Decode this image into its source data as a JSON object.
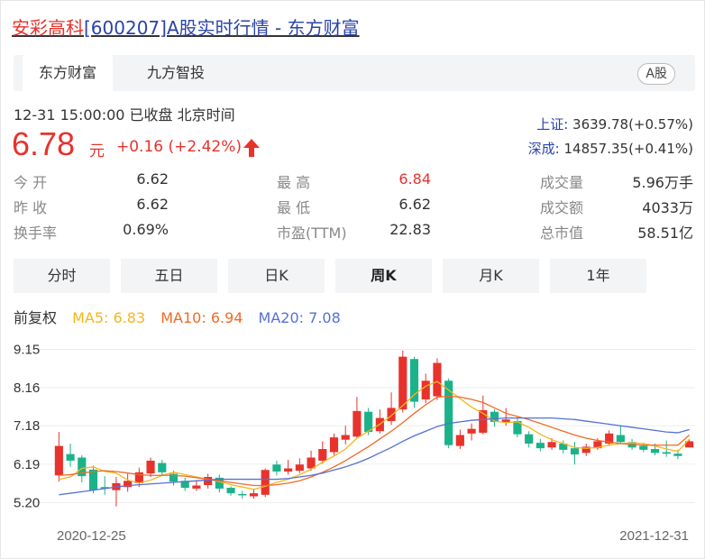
{
  "title": {
    "name": "安彩高科",
    "rest": "[600207]A股实时行情 - 东方财富"
  },
  "tabs": [
    {
      "label": "东方财富",
      "active": true
    },
    {
      "label": "九方智投",
      "active": false
    }
  ],
  "market_badge": "A股",
  "status": "12-31 15:00:00  已收盘  北京时间",
  "indices": [
    {
      "name": "上证:",
      "value": "3639.78(+0.57%)"
    },
    {
      "name": "深成:",
      "value": "14857.35(+0.41%)"
    }
  ],
  "quote": {
    "price": "6.78",
    "unit": "元",
    "change": "+0.16 (+2.42%)",
    "direction": "up"
  },
  "stats": [
    {
      "label": "今 开",
      "value": "6.62",
      "up": false
    },
    {
      "label": "最 高",
      "value": "6.84",
      "up": true
    },
    {
      "label": "成交量",
      "value": "5.96万手",
      "up": false
    },
    {
      "label": "昨 收",
      "value": "6.62",
      "up": false
    },
    {
      "label": "最 低",
      "value": "6.62",
      "up": false
    },
    {
      "label": "成交额",
      "value": "4033万",
      "up": false
    },
    {
      "label": "换手率",
      "value": "0.69%",
      "up": false
    },
    {
      "label": "市盈(TTM)",
      "value": "22.83",
      "up": false
    },
    {
      "label": "总市值",
      "value": "58.51亿",
      "up": false
    }
  ],
  "period_tabs": [
    {
      "label": "分时",
      "active": false
    },
    {
      "label": "五日",
      "active": false
    },
    {
      "label": "日K",
      "active": false
    },
    {
      "label": "周K",
      "active": true
    },
    {
      "label": "月K",
      "active": false
    },
    {
      "label": "1年",
      "active": false
    }
  ],
  "legend": {
    "adjust": "前复权",
    "ma5": "MA5: 6.83",
    "ma10": "MA10: 6.94",
    "ma20": "MA20: 7.08"
  },
  "colors": {
    "up": "#e8322c",
    "down": "#1bb28a",
    "ma5": "#f4b61e",
    "ma10": "#f06a26",
    "ma20": "#5370d8",
    "link": "#2a44a8"
  },
  "chart_data": {
    "type": "candlestick",
    "y_ticks": [
      "9.15",
      "8.16",
      "7.18",
      "6.19",
      "5.20"
    ],
    "ylim": [
      5.0,
      9.3
    ],
    "x_labels": [
      "2020-12-25",
      "2021-12-31"
    ],
    "grid": true,
    "candles": [
      {
        "o": 5.9,
        "c": 6.66,
        "h": 7.02,
        "l": 5.74
      },
      {
        "o": 6.45,
        "c": 6.28,
        "h": 6.72,
        "l": 6.12
      },
      {
        "o": 6.36,
        "c": 5.88,
        "h": 6.42,
        "l": 5.72
      },
      {
        "o": 6.05,
        "c": 5.52,
        "h": 6.15,
        "l": 5.44
      },
      {
        "o": 5.6,
        "c": 5.57,
        "h": 5.88,
        "l": 5.4
      },
      {
        "o": 5.52,
        "c": 5.7,
        "h": 5.86,
        "l": 5.1
      },
      {
        "o": 5.6,
        "c": 5.76,
        "h": 5.94,
        "l": 5.48
      },
      {
        "o": 5.7,
        "c": 5.98,
        "h": 6.1,
        "l": 5.6
      },
      {
        "o": 5.95,
        "c": 6.28,
        "h": 6.36,
        "l": 5.86
      },
      {
        "o": 6.22,
        "c": 5.98,
        "h": 6.3,
        "l": 5.9
      },
      {
        "o": 5.94,
        "c": 5.74,
        "h": 6.02,
        "l": 5.64
      },
      {
        "o": 5.76,
        "c": 5.58,
        "h": 5.84,
        "l": 5.5
      },
      {
        "o": 5.56,
        "c": 5.64,
        "h": 5.78,
        "l": 5.5
      },
      {
        "o": 5.65,
        "c": 5.86,
        "h": 5.94,
        "l": 5.56
      },
      {
        "o": 5.84,
        "c": 5.56,
        "h": 5.92,
        "l": 5.46
      },
      {
        "o": 5.58,
        "c": 5.44,
        "h": 5.62,
        "l": 5.38
      },
      {
        "o": 5.42,
        "c": 5.4,
        "h": 5.5,
        "l": 5.3
      },
      {
        "o": 5.36,
        "c": 5.44,
        "h": 5.56,
        "l": 5.3
      },
      {
        "o": 5.4,
        "c": 6.04,
        "h": 6.08,
        "l": 5.34
      },
      {
        "o": 6.18,
        "c": 6.0,
        "h": 6.28,
        "l": 5.9
      },
      {
        "o": 6.0,
        "c": 6.08,
        "h": 6.3,
        "l": 5.92
      },
      {
        "o": 6.02,
        "c": 6.18,
        "h": 6.34,
        "l": 5.96
      },
      {
        "o": 6.08,
        "c": 6.36,
        "h": 6.54,
        "l": 6.02
      },
      {
        "o": 6.28,
        "c": 6.58,
        "h": 6.78,
        "l": 6.2
      },
      {
        "o": 6.5,
        "c": 6.88,
        "h": 6.98,
        "l": 6.42
      },
      {
        "o": 6.82,
        "c": 6.94,
        "h": 7.18,
        "l": 6.7
      },
      {
        "o": 6.9,
        "c": 7.56,
        "h": 7.92,
        "l": 6.86
      },
      {
        "o": 7.54,
        "c": 7.02,
        "h": 7.64,
        "l": 6.94
      },
      {
        "o": 7.04,
        "c": 7.38,
        "h": 7.6,
        "l": 6.98
      },
      {
        "o": 7.3,
        "c": 7.64,
        "h": 8.04,
        "l": 7.2
      },
      {
        "o": 7.6,
        "c": 8.96,
        "h": 9.12,
        "l": 7.52
      },
      {
        "o": 8.9,
        "c": 7.8,
        "h": 8.96,
        "l": 7.64
      },
      {
        "o": 7.86,
        "c": 8.34,
        "h": 8.52,
        "l": 7.76
      },
      {
        "o": 7.94,
        "c": 8.8,
        "h": 8.92,
        "l": 7.84
      },
      {
        "o": 8.34,
        "c": 6.68,
        "h": 8.4,
        "l": 6.6
      },
      {
        "o": 6.66,
        "c": 6.94,
        "h": 7.08,
        "l": 6.58
      },
      {
        "o": 6.98,
        "c": 7.1,
        "h": 7.24,
        "l": 6.8
      },
      {
        "o": 7.0,
        "c": 7.58,
        "h": 7.96,
        "l": 6.96
      },
      {
        "o": 7.54,
        "c": 7.28,
        "h": 7.6,
        "l": 7.16
      },
      {
        "o": 7.28,
        "c": 7.34,
        "h": 7.64,
        "l": 7.18
      },
      {
        "o": 7.3,
        "c": 6.96,
        "h": 7.4,
        "l": 6.88
      },
      {
        "o": 6.96,
        "c": 6.72,
        "h": 7.04,
        "l": 6.62
      },
      {
        "o": 6.74,
        "c": 6.6,
        "h": 6.84,
        "l": 6.52
      },
      {
        "o": 6.62,
        "c": 6.76,
        "h": 6.86,
        "l": 6.56
      },
      {
        "o": 6.72,
        "c": 6.56,
        "h": 6.8,
        "l": 6.46
      },
      {
        "o": 6.6,
        "c": 6.44,
        "h": 6.76,
        "l": 6.18
      },
      {
        "o": 6.48,
        "c": 6.64,
        "h": 6.72,
        "l": 6.4
      },
      {
        "o": 6.6,
        "c": 6.78,
        "h": 6.86,
        "l": 6.56
      },
      {
        "o": 6.72,
        "c": 6.98,
        "h": 7.06,
        "l": 6.66
      },
      {
        "o": 6.94,
        "c": 6.76,
        "h": 7.2,
        "l": 6.7
      },
      {
        "o": 6.76,
        "c": 6.62,
        "h": 6.84,
        "l": 6.56
      },
      {
        "o": 6.66,
        "c": 6.56,
        "h": 6.74,
        "l": 6.5
      },
      {
        "o": 6.58,
        "c": 6.48,
        "h": 6.72,
        "l": 6.42
      },
      {
        "o": 6.5,
        "c": 6.46,
        "h": 6.8,
        "l": 6.38
      },
      {
        "o": 6.46,
        "c": 6.4,
        "h": 6.56,
        "l": 6.32
      },
      {
        "o": 6.62,
        "c": 6.78,
        "h": 6.84,
        "l": 6.62
      }
    ],
    "series": [
      {
        "name": "MA5",
        "values": [
          5.8,
          5.86,
          6.08,
          6.12,
          6.0,
          5.96,
          5.78,
          5.7,
          5.78,
          5.9,
          5.98,
          5.92,
          5.86,
          5.8,
          5.74,
          5.66,
          5.6,
          5.54,
          5.62,
          5.72,
          5.8,
          5.92,
          6.06,
          6.24,
          6.4,
          6.58,
          6.86,
          7.04,
          7.22,
          7.44,
          7.7,
          7.98,
          8.2,
          8.32,
          8.1,
          7.88,
          7.66,
          7.5,
          7.3,
          7.26,
          7.28,
          7.14,
          6.96,
          6.82,
          6.72,
          6.62,
          6.6,
          6.62,
          6.68,
          6.72,
          6.74,
          6.72,
          6.66,
          6.58,
          6.52,
          6.83
        ]
      },
      {
        "name": "MA10",
        "values": [
          5.9,
          5.92,
          5.96,
          6.0,
          6.02,
          6.0,
          5.96,
          5.92,
          5.9,
          5.9,
          5.9,
          5.88,
          5.84,
          5.8,
          5.76,
          5.72,
          5.68,
          5.64,
          5.64,
          5.66,
          5.7,
          5.76,
          5.86,
          5.98,
          6.12,
          6.28,
          6.46,
          6.64,
          6.84,
          7.04,
          7.26,
          7.5,
          7.72,
          7.92,
          7.94,
          7.92,
          7.86,
          7.78,
          7.64,
          7.5,
          7.42,
          7.34,
          7.24,
          7.14,
          7.04,
          6.94,
          6.86,
          6.8,
          6.76,
          6.72,
          6.7,
          6.68,
          6.68,
          6.68,
          6.68,
          6.94
        ]
      },
      {
        "name": "MA20",
        "values": [
          5.4,
          5.44,
          5.48,
          5.52,
          5.56,
          5.6,
          5.64,
          5.66,
          5.68,
          5.7,
          5.72,
          5.74,
          5.76,
          5.78,
          5.8,
          5.8,
          5.8,
          5.8,
          5.8,
          5.8,
          5.82,
          5.86,
          5.9,
          5.96,
          6.04,
          6.12,
          6.22,
          6.34,
          6.48,
          6.62,
          6.78,
          6.92,
          7.04,
          7.16,
          7.24,
          7.28,
          7.32,
          7.34,
          7.36,
          7.38,
          7.38,
          7.38,
          7.38,
          7.38,
          7.36,
          7.34,
          7.3,
          7.26,
          7.22,
          7.18,
          7.14,
          7.1,
          7.06,
          7.02,
          7.0,
          7.08
        ]
      }
    ]
  }
}
